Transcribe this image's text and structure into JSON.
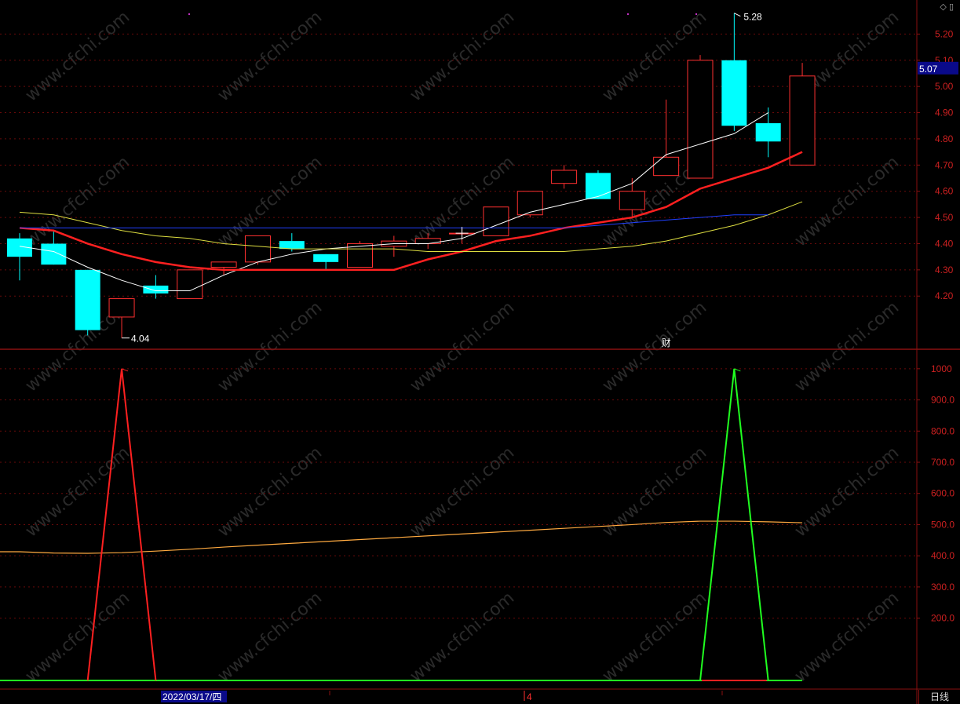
{
  "chart_data": [
    {
      "type": "candlestick",
      "dates": [
        "2022/03/17/四"
      ],
      "ohlc": [
        [
          4.42,
          4.44,
          4.26,
          4.35
        ],
        [
          4.4,
          4.45,
          4.32,
          4.32
        ],
        [
          4.3,
          4.3,
          4.05,
          4.07
        ],
        [
          4.12,
          4.19,
          4.04,
          4.19
        ],
        [
          4.24,
          4.28,
          4.19,
          4.21
        ],
        [
          4.19,
          4.3,
          4.19,
          4.3
        ],
        [
          4.31,
          4.33,
          4.28,
          4.33
        ],
        [
          4.33,
          4.43,
          4.32,
          4.43
        ],
        [
          4.41,
          4.44,
          4.37,
          4.38
        ],
        [
          4.36,
          4.36,
          4.3,
          4.33
        ],
        [
          4.31,
          4.41,
          4.31,
          4.4
        ],
        [
          4.39,
          4.43,
          4.35,
          4.41
        ],
        [
          4.4,
          4.44,
          4.38,
          4.42
        ],
        [
          4.44,
          4.46,
          4.4,
          4.44
        ],
        [
          4.43,
          4.54,
          4.43,
          4.54
        ],
        [
          4.51,
          4.6,
          4.5,
          4.6
        ],
        [
          4.63,
          4.7,
          4.61,
          4.68
        ],
        [
          4.67,
          4.68,
          4.57,
          4.57
        ],
        [
          4.53,
          4.65,
          4.5,
          4.6
        ],
        [
          4.66,
          4.95,
          4.66,
          4.73
        ],
        [
          4.65,
          5.12,
          4.65,
          5.1
        ],
        [
          5.1,
          5.28,
          4.83,
          4.85
        ],
        [
          4.86,
          4.92,
          4.73,
          4.79
        ],
        [
          4.7,
          5.09,
          4.7,
          5.04
        ]
      ],
      "ma_series": [
        {
          "color": "#ffffff",
          "values": [
            4.39,
            4.37,
            4.31,
            4.26,
            4.22,
            4.22,
            4.28,
            4.33,
            4.36,
            4.38,
            4.39,
            4.4,
            4.4,
            4.42,
            4.47,
            4.52,
            4.55,
            4.58,
            4.63,
            4.74,
            4.78,
            4.82,
            4.9
          ]
        },
        {
          "color": "#ff2020",
          "values": [
            4.46,
            4.45,
            4.4,
            4.36,
            4.33,
            4.31,
            4.3,
            4.3,
            4.3,
            4.3,
            4.3,
            4.3,
            4.34,
            4.37,
            4.41,
            4.43,
            4.46,
            4.48,
            4.5,
            4.54,
            4.61,
            4.65,
            4.69,
            4.75
          ]
        },
        {
          "color": "#dddd40",
          "values": [
            4.52,
            4.51,
            4.48,
            4.45,
            4.43,
            4.42,
            4.4,
            4.39,
            4.38,
            4.38,
            4.38,
            4.38,
            4.37,
            4.37,
            4.37,
            4.37,
            4.37,
            4.38,
            4.39,
            4.41,
            4.44,
            4.47,
            4.51,
            4.56
          ]
        },
        {
          "color": "#2040ff",
          "values": [
            4.46,
            4.46,
            4.46,
            4.46,
            4.46,
            4.46,
            4.46,
            4.46,
            4.46,
            4.46,
            4.46,
            4.46,
            4.46,
            4.46,
            4.46,
            4.46,
            4.46,
            4.47,
            4.48,
            4.49,
            4.5,
            4.51,
            4.51
          ]
        }
      ],
      "y_ticks": [
        "5.20",
        "5.10",
        "5.00",
        "4.90",
        "4.80",
        "4.70",
        "4.60",
        "4.50",
        "4.40",
        "4.30",
        "4.20"
      ],
      "ylim": [
        4.0,
        5.33
      ],
      "current_price": "5.07",
      "high_label": "5.28",
      "low_label": "4.04",
      "annotation": "财",
      "grid": true
    },
    {
      "type": "line",
      "y_ticks": [
        "1000",
        "900.0",
        "800.0",
        "700.0",
        "600.0",
        "500.0",
        "400.0",
        "300.0",
        "200.0"
      ],
      "ylim": [
        -20,
        1060
      ],
      "spike_red": [
        0,
        0,
        0,
        1000,
        0,
        0,
        0,
        0,
        0,
        0,
        0,
        0,
        0,
        0,
        0,
        0,
        0,
        0,
        0,
        0,
        0,
        0,
        0,
        0
      ],
      "spike_green": [
        0,
        0,
        0,
        0,
        0,
        0,
        0,
        0,
        0,
        0,
        0,
        0,
        0,
        0,
        0,
        0,
        0,
        0,
        0,
        0,
        0,
        1000,
        0,
        0
      ],
      "avg_line": [
        413,
        409,
        408,
        410,
        415,
        421,
        428,
        434,
        440,
        446,
        452,
        458,
        464,
        470,
        476,
        482,
        488,
        494,
        500,
        507,
        511,
        511,
        509,
        506
      ],
      "x_ticks": [
        "2022/03/17/四",
        "4"
      ],
      "period": "日线",
      "grid": true
    }
  ]
}
